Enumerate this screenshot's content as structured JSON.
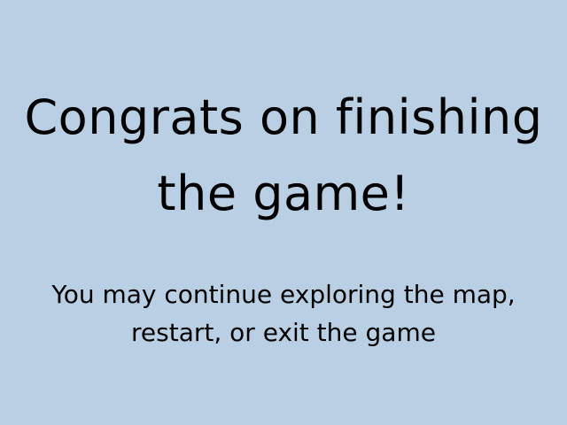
{
  "screen": {
    "background_color": "#b9cfe3",
    "title_lines": [
      "Congrats on finishing",
      "the game!"
    ],
    "subtitle_lines": [
      "You may continue exploring the map,",
      "restart, or exit the game"
    ]
  }
}
